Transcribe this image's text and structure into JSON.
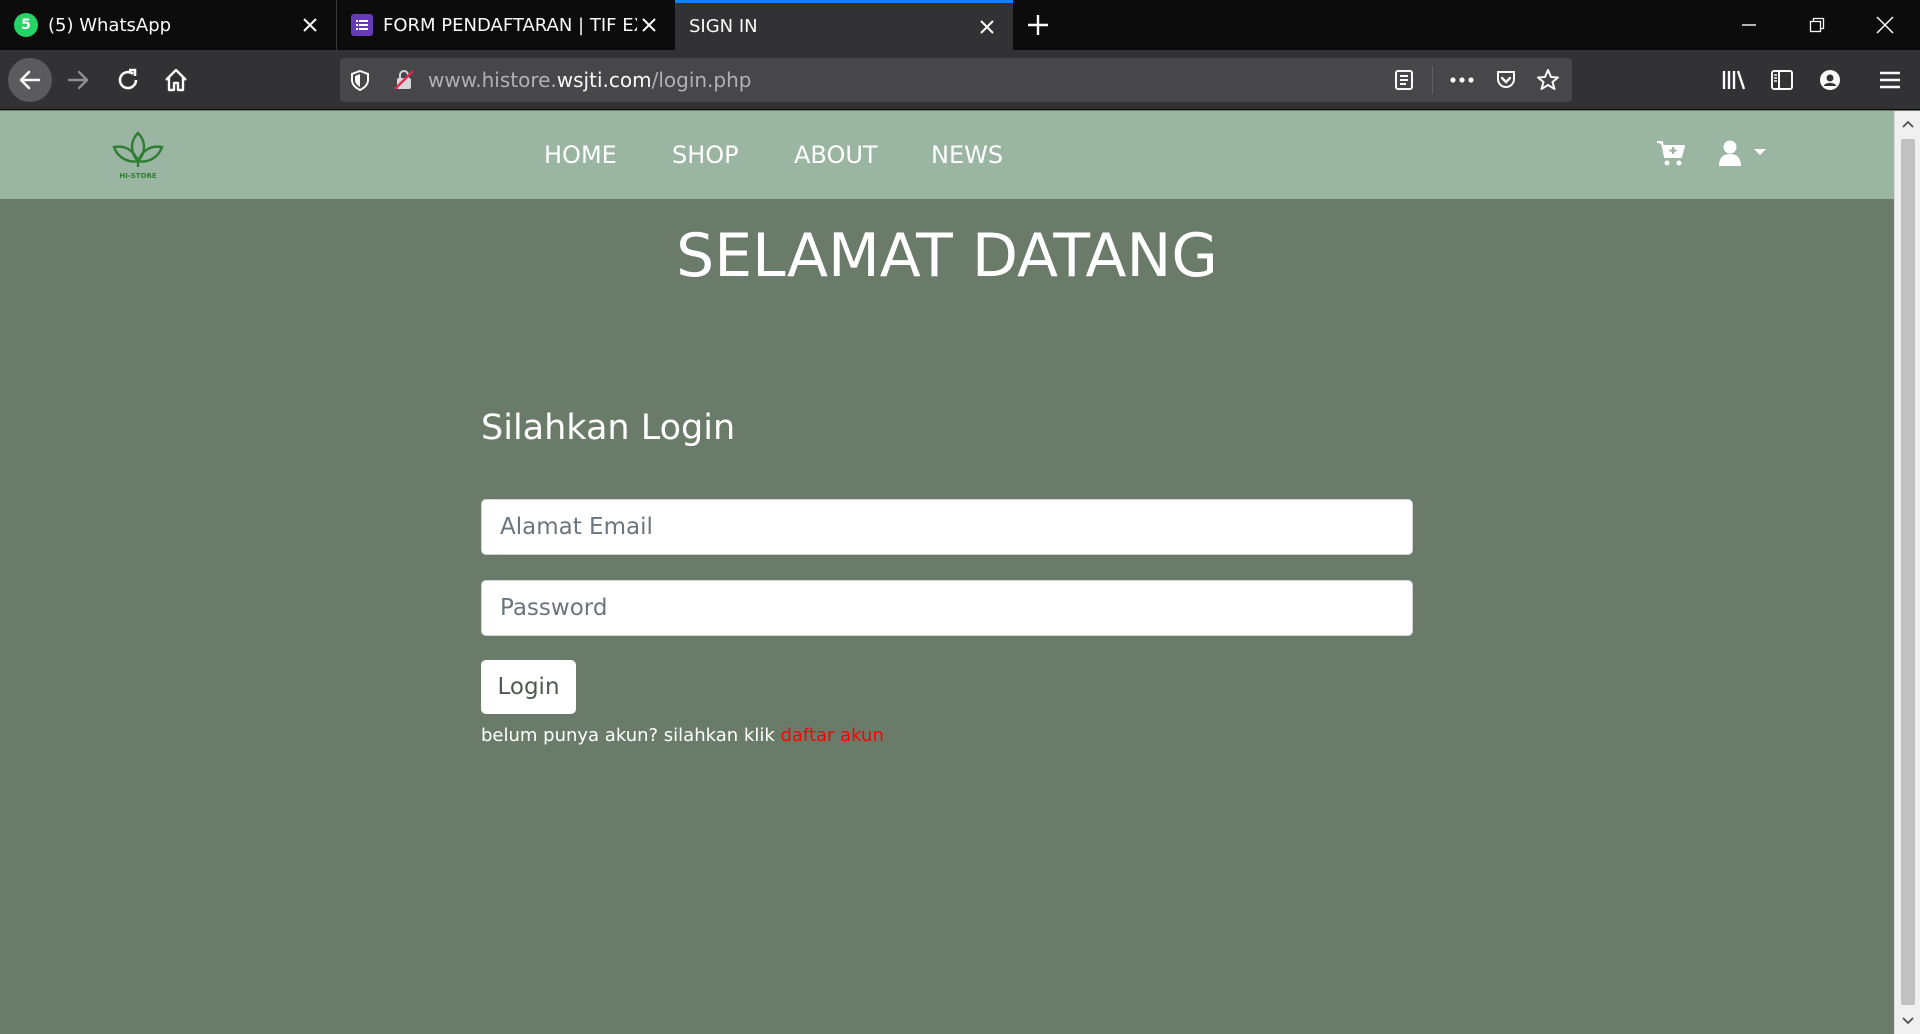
{
  "browser": {
    "tabs": [
      {
        "title": "(5) WhatsApp",
        "badge": "5"
      },
      {
        "title": "FORM PENDAFTARAN | TIF EXHIBITION"
      },
      {
        "title": "SIGN IN"
      }
    ],
    "url": {
      "prefix": "www.histore.",
      "domain": "wsjti.com",
      "path": "/login.php"
    }
  },
  "site": {
    "logo_text": "HI-STORE",
    "menu": [
      "HOME",
      "SHOP",
      "ABOUT",
      "NEWS"
    ],
    "welcome": "SELAMAT DATANG",
    "login": {
      "title": "Silahkan Login",
      "email_placeholder": "Alamat Email",
      "password_placeholder": "Password",
      "button_label": "Login",
      "register_prompt": "belum punya akun? silahkan klik ",
      "register_link": "daftar akun"
    }
  },
  "colors": {
    "page_bg": "#6b7b69",
    "header_bg": "#9bb5a3",
    "link_red": "#ff0000",
    "tab_accent": "#0a84ff"
  },
  "icons": [
    "whatsapp-icon",
    "forms-icon",
    "close-icon",
    "plus-icon",
    "minimize-icon",
    "restore-icon",
    "back-icon",
    "forward-icon",
    "reload-icon",
    "home-icon",
    "shield-icon",
    "insecure-lock-icon",
    "reader-icon",
    "more-icon",
    "pocket-icon",
    "star-icon",
    "library-icon",
    "sidebar-icon",
    "account-icon",
    "menu-icon",
    "cart-icon",
    "user-icon",
    "caret-down-icon"
  ]
}
